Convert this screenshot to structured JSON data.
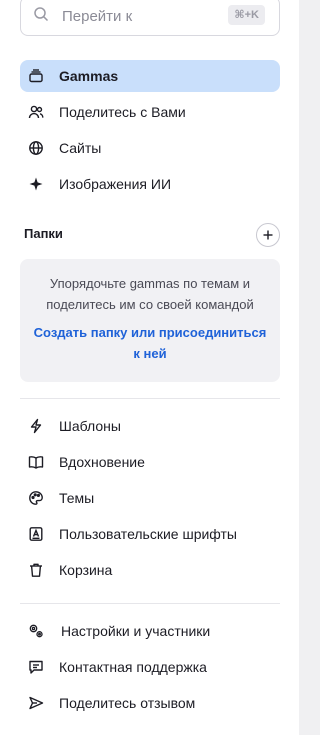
{
  "search": {
    "placeholder": "Перейти к",
    "shortcut": "⌘+K"
  },
  "nav": {
    "gammas": "Gammas",
    "shared": "Поделитесь с Вами",
    "sites": "Сайты",
    "ai_images": "Изображения ИИ"
  },
  "folders": {
    "title": "Папки",
    "empty_text": "Упорядочьте gammas по темам и поделитесь им со своей командой",
    "create_link": "Создать папку или присоединиться к ней"
  },
  "tools": {
    "templates": "Шаблоны",
    "inspiration": "Вдохновение",
    "themes": "Темы",
    "custom_fonts": "Пользовательские шрифты",
    "trash": "Корзина"
  },
  "footer": {
    "settings": "Настройки и участники",
    "support": "Контактная поддержка",
    "feedback": "Поделитесь отзывом"
  },
  "colors": {
    "active_bg": "#c9dffb",
    "link": "#1f62d8"
  },
  "icons": {
    "search": "search-icon",
    "gammas": "stack-icon",
    "shared": "users-icon",
    "sites": "globe-icon",
    "ai_images": "sparkle-icon",
    "add": "plus-icon",
    "templates": "bolt-icon",
    "inspiration": "book-icon",
    "themes": "palette-icon",
    "custom_fonts": "font-icon",
    "trash": "trash-icon",
    "settings": "gears-icon",
    "support": "chat-icon",
    "feedback": "send-icon"
  }
}
